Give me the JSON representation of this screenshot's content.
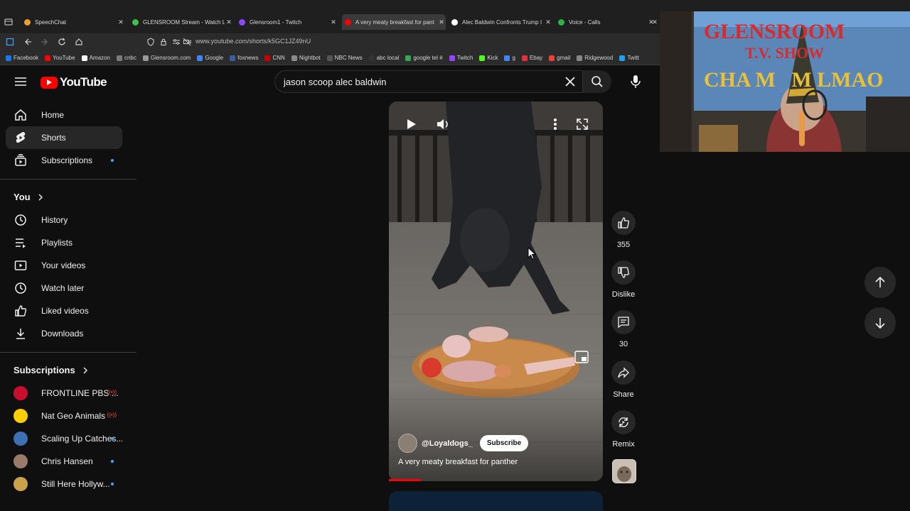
{
  "browser": {
    "tabs": [
      {
        "title": "SpeechChat",
        "close": "✕",
        "color": "#f0a030"
      },
      {
        "title": "GLENSROOM Stream - Watch L",
        "close": "✕",
        "color": "#3cc24a"
      },
      {
        "title": "Glensroom1 - Twitch",
        "close": "✕",
        "color": "#9146ff"
      },
      {
        "title": "A very meaty breakfast for pant",
        "close": "✕",
        "color": "#ff0000"
      },
      {
        "title": "Alec Baldwin Confronts Trump I",
        "close": "✕",
        "color": "#ffffff"
      },
      {
        "title": "Voice - Calls",
        "close": "✕",
        "color": "#2bb24c"
      }
    ],
    "url": "www.youtube.com/shorts/k5GC1JZ49nU",
    "bookmarks": [
      {
        "label": "Facebook",
        "color": "#1877f2"
      },
      {
        "label": "YouTube",
        "color": "#ff0000"
      },
      {
        "label": "Amazon",
        "color": "#ffffff"
      },
      {
        "label": "cnbc",
        "color": "#7a7a7a"
      },
      {
        "label": "Glensroom.com",
        "color": "#9a9a9a"
      },
      {
        "label": "Google",
        "color": "#4285f4"
      },
      {
        "label": "foxnews",
        "color": "#3b5f9a"
      },
      {
        "label": "CNN",
        "color": "#cc0000"
      },
      {
        "label": "Nightbot",
        "color": "#8a8a8a"
      },
      {
        "label": "NBC News",
        "color": "#555555"
      },
      {
        "label": "abc local",
        "color": "#333333"
      },
      {
        "label": "google tel #",
        "color": "#34a853"
      },
      {
        "label": "Twitch",
        "color": "#9146ff"
      },
      {
        "label": "Kick",
        "color": "#53fc18"
      },
      {
        "label": "g",
        "color": "#4285f4"
      },
      {
        "label": "Ebay",
        "color": "#e53238"
      },
      {
        "label": "gmail",
        "color": "#ea4335"
      },
      {
        "label": "Ridgewood",
        "color": "#888888"
      },
      {
        "label": "Twitt",
        "color": "#1da1f2"
      }
    ]
  },
  "youtube": {
    "logo_text": "YouTube",
    "search_query": "jason scoop alec baldwin",
    "sidebar": {
      "main": [
        {
          "label": "Home",
          "icon": "home-icon"
        },
        {
          "label": "Shorts",
          "icon": "shorts-icon",
          "active": true
        },
        {
          "label": "Subscriptions",
          "icon": "subscriptions-icon",
          "dot": true
        }
      ],
      "you_heading": "You",
      "you": [
        {
          "label": "History",
          "icon": "history-icon"
        },
        {
          "label": "Playlists",
          "icon": "playlists-icon"
        },
        {
          "label": "Your videos",
          "icon": "your-videos-icon"
        },
        {
          "label": "Watch later",
          "icon": "watch-later-icon"
        },
        {
          "label": "Liked videos",
          "icon": "liked-videos-icon"
        },
        {
          "label": "Downloads",
          "icon": "downloads-icon"
        }
      ],
      "subs_heading": "Subscriptions",
      "subscriptions": [
        {
          "label": "FRONTLINE PBS ...",
          "live": true,
          "color": "#c8102e"
        },
        {
          "label": "Nat Geo Animals",
          "live": true,
          "color": "#ffce00"
        },
        {
          "label": "Scaling Up Catches...",
          "dot": true,
          "color": "#3d6fb3"
        },
        {
          "label": "Chris Hansen",
          "dot": true,
          "color": "#9a7b6a"
        },
        {
          "label": "Still Here Hollyw...",
          "dot": true,
          "color": "#c9a24a"
        }
      ]
    },
    "short": {
      "channel": "@Loyaldogs_",
      "subscribe": "Subscribe",
      "caption": "A very meaty breakfast for panther",
      "likes": "355",
      "dislike_label": "Dislike",
      "comments": "30",
      "share_label": "Share",
      "remix_label": "Remix",
      "progress": 0.15
    }
  },
  "webcam": {
    "banner_line1": "GLENSROOM",
    "banner_line2": "T.V. SHOW",
    "banner_line3": "CHA M   M LMAO"
  }
}
